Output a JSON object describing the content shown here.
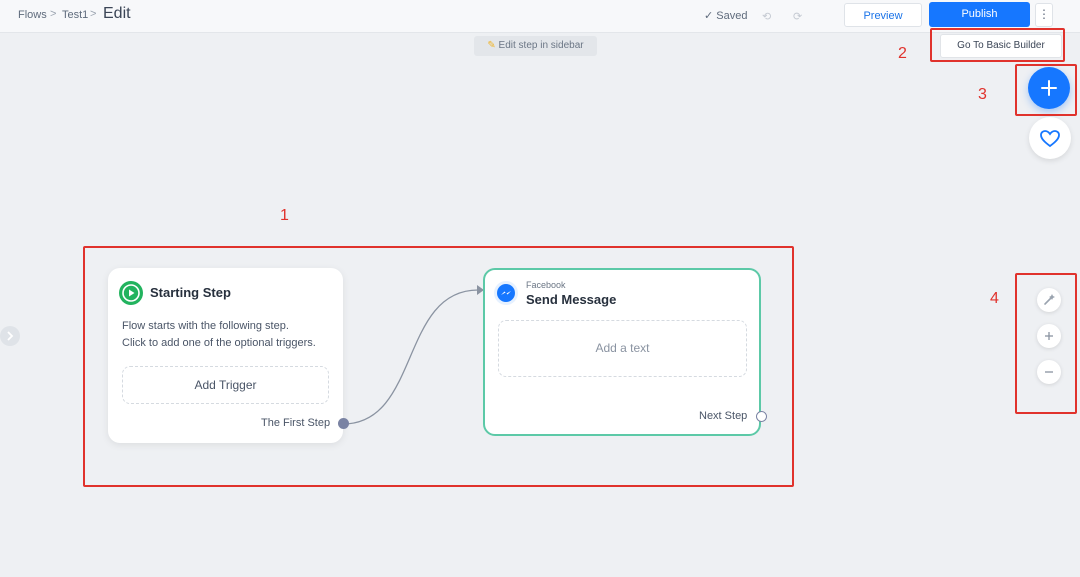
{
  "breadcrumb": {
    "flows": "Flows",
    "sep1": ">",
    "test": "Test1",
    "sep2": ">",
    "title": "Edit"
  },
  "toolbar": {
    "saved": "Saved",
    "undo": "⟲",
    "redo": "⟳",
    "preview": "Preview",
    "publish": "Publish",
    "more": "⋮"
  },
  "hint": {
    "text": "Edit step in sidebar"
  },
  "basic_builder": {
    "label": "Go To Basic Builder"
  },
  "annotations": {
    "a1": "1",
    "a2": "2",
    "a3": "3",
    "a4": "4"
  },
  "start_card": {
    "title": "Starting Step",
    "desc_line1": "Flow starts with the following step.",
    "desc_line2": "Click to add one of the optional triggers.",
    "add_trigger": "Add Trigger",
    "first_step": "The First Step"
  },
  "fb_card": {
    "platform": "Facebook",
    "title": "Send Message",
    "add_text": "Add a text",
    "next_step": "Next Step"
  },
  "colors": {
    "accent": "#1677ff",
    "annotation": "#e0322c",
    "start_icon": "#22b35e",
    "fb_border": "#5cc9a7"
  },
  "icons": [
    "play-icon",
    "messenger-icon",
    "plus-icon",
    "heart-icon",
    "magic-wand-icon",
    "zoom-in-icon",
    "zoom-out-icon",
    "check-icon"
  ]
}
